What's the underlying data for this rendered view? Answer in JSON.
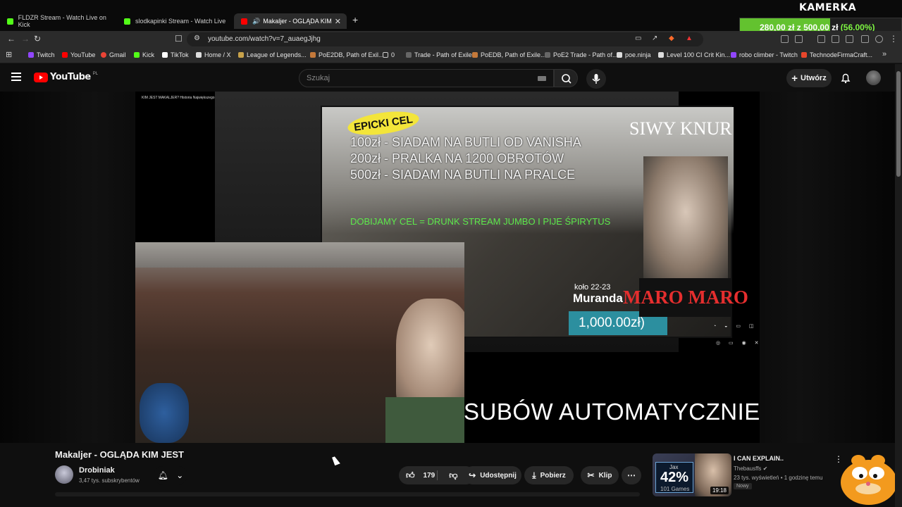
{
  "browser": {
    "tabs": [
      {
        "title": "FLDZR Stream - Watch Live on Kick",
        "favicon": "kick-icon"
      },
      {
        "title": "slodkapinki Stream - Watch Live on K",
        "favicon": "kick-icon"
      },
      {
        "title": "Makaljer - OGLĄDA KIM JEST",
        "favicon": "youtube-icon"
      }
    ],
    "url": "youtube.com/watch?v=7_auaegJjhg",
    "bookmarks": [
      "Twitch",
      "YouTube",
      "Gmail",
      "Kick",
      "TikTok",
      "Home / X",
      "League of Legends...",
      "PoE2DB, Path of Exil...",
      "0",
      "Trade - Path of Exile",
      "PoEDB, Path of Exile...",
      "PoE2 Trade - Path of...",
      "poe.ninja",
      "Level 100 CI Crit Kin...",
      "robo climber - Twitch",
      "TechnodeFirmaCraft..."
    ]
  },
  "overlay": {
    "label": "KAMERKA",
    "current": "280,00 zł",
    "separator": "z",
    "goal": "500,00 zł",
    "percent_text": "(56.00%)",
    "progress_fraction": 0.56,
    "accent": "#63c22f"
  },
  "youtube": {
    "country": "PL",
    "search_placeholder": "Szukaj",
    "create_label": "Utwórz"
  },
  "video": {
    "inner_title": "KIM JEST MAKALJER? Historia Największego Specjalisty AI w Polsce!",
    "badge": "EPICKI CEL",
    "goal_lines": [
      "100zł - SIADAM NA BUTLI OD VANISHA",
      "200zł - PRALKA NA 1200 OBROTÓW",
      "500zł - SIADAM NA BUTLI NA PRALCE"
    ],
    "siwy": "SIWY KNUR",
    "dobijamy": "DOBIJAMY CEL = DRUNK STREAM JUMBO I PIJE ŚPIRYTUS",
    "kolo": "koło  22-23",
    "muranda": "Muranda",
    "amount": "1,000.00zł)",
    "maro": "MARO MARO",
    "subtitle": "SUBÓW AUTOMATYCZNIE",
    "title": "Makaljer - OGLĄDA KIM JEST",
    "channel": "Drobiniak",
    "subscribers": "3,47 tys. subskrybentów",
    "likes": "179",
    "share_label": "Udostępnij",
    "download_label": "Pobierz",
    "clip_label": "Klip"
  },
  "recommended": {
    "title": "I CAN EXPLAIN..",
    "channel": "Thebausffs",
    "meta": "23 tys. wyświetleń • 1 godzinę temu",
    "badge": "Nowy",
    "duration": "19:18",
    "thumb_name": "Jax",
    "thumb_pct": "42%",
    "thumb_games": "101 Games"
  }
}
